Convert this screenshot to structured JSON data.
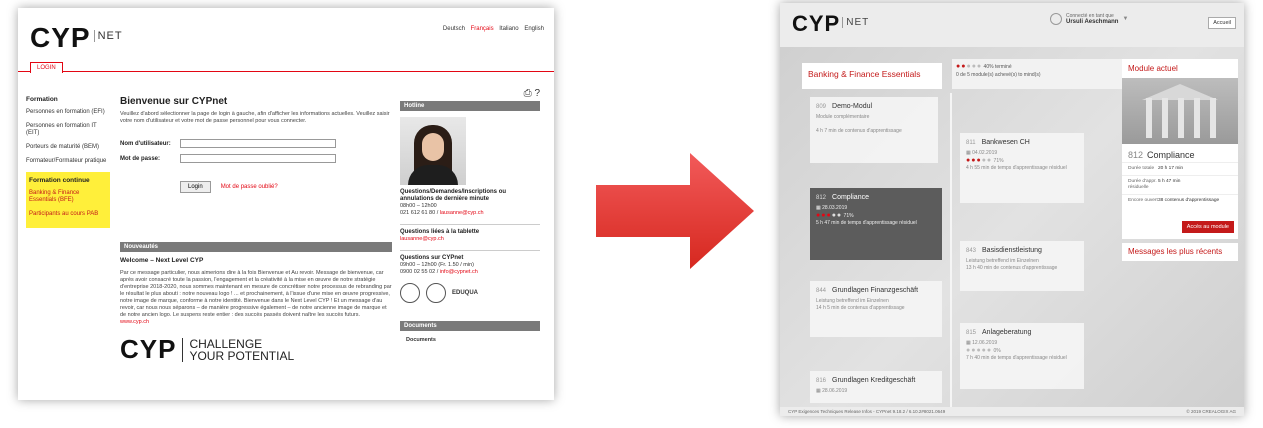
{
  "left": {
    "logo": "CYP",
    "logo_net": "NET",
    "languages": [
      "Deutsch",
      "Français",
      "Italiano",
      "English"
    ],
    "login_tab": "LOGIN",
    "sidebar": {
      "formation_head": "Formation",
      "items": [
        "Personnes en formation (EFI)",
        "Personnes en formation IT (EIT)",
        "Porteurs de maturité (BEM)",
        "Formateur/Formateur pratique"
      ],
      "continue_head": "Formation continue",
      "continue_items": [
        "Banking & Finance Essentials (BFE)",
        "Participants au cours PAB"
      ]
    },
    "welcome_title": "Bienvenue sur CYPnet",
    "welcome_text": "Veuillez d'abord sélectionner la page de login à gauche, afin d'afficher les informations actuelles. Veuillez saisir votre nom d'utilisateur et votre mot de passe personnel pour vous connecter.",
    "username_label": "Nom d'utilisateur:",
    "password_label": "Mot de passe:",
    "login_button": "Login",
    "forgot_link": "Mot de passe oublié?",
    "news_bar": "Nouveautés",
    "news_title": "Welcome – Next Level CYP",
    "news_text": "Par ce message particulier, nous aimerions dire à la fois Bienvenue et Au revoir. Message de bienvenue, car après avoir consacré toute la passion, l'engagement et la créativité à la mise en œuvre de notre stratégie d'entreprise 2018-2020, nous sommes maintenant en mesure de concrétiser notre processus de rebranding par le résultat le plus abouti : notre nouveau logo ! ... et prochainement, à l'issue d'une mise en œuvre progressive, notre image de marque, conforme à notre identité. Bienvenue dans le Next Level CYP ! Et un message d'au revoir, car nous nous séparons – de manière progressive également – de notre ancienne image de marque et de notre ancien logo. Le suspens reste entier : des succès passés doivent naître les succès futurs.",
    "news_link": "www.cyp.ch",
    "tagline_1": "CHALLENGE",
    "tagline_2": "YOUR POTENTIAL",
    "hotline_bar": "Hotline",
    "hotline_title": "Questions/Demandes/Inscriptions ou annulations de dernière minute",
    "hotline_hours": "08h00 – 12h00",
    "hotline_phone": "021 612 61 80 /",
    "hotline_email": "lausanne@cyp.ch",
    "tablet_title": "Questions liées à la tablette",
    "tablet_email": "lausanne@cyp.ch",
    "cypnet_title": "Questions sur CYPnet",
    "cypnet_hours": "09h00 – 12h00 (Fr. 1.50 / min)",
    "cypnet_phone": "0900 02 55 02 /",
    "cypnet_email": "info@cypnet.ch",
    "badge_text": "EDUQUA",
    "documents_bar": "Documents",
    "documents_link": "Documents"
  },
  "right": {
    "logo": "CYP",
    "logo_net": "NET",
    "user_label": "Connecté en tant que",
    "user_name": "Ursuli Aeschmann",
    "accueil_button": "Accueil",
    "course_title": "Banking & Finance Essentials",
    "progress_pct": "40% terminé",
    "progress_modules": "0 de 5 module(s) achevé(s) to mind(s)",
    "cards": [
      {
        "num": "809",
        "title": "Demo-Modul",
        "sub": "Module complémentaire",
        "time": "4 h 7 min de contenus d'apprentissage"
      },
      {
        "num": "811",
        "title": "Bankwesen CH",
        "date": "04.02.2019",
        "pct": "71%",
        "time": "4 h 55 min de temps d'apprentissage résiduel"
      },
      {
        "num": "812",
        "title": "Compliance",
        "date": "28.03.2019",
        "pct": "71%",
        "time": "5 h 47 min de temps d'apprentissage résiduel"
      },
      {
        "num": "843",
        "title": "Basisdienstleistung",
        "sub": "Leistung betreffend im Einzelnen",
        "time": "13 h 40 min de contenus d'apprentissage"
      },
      {
        "num": "844",
        "title": "Grundlagen Finanzgeschäft",
        "sub": "Leistung betreffend im Einzelnen",
        "time": "14 h 5 min de contenus d'apprentissage"
      },
      {
        "num": "815",
        "title": "Anlageberatung",
        "date": "12.06.2019",
        "pct": "0%",
        "time": "7 h 40 min de temps d'apprentissage résiduel"
      },
      {
        "num": "816",
        "title": "Grundlagen Kreditgeschäft",
        "date": "28.06.2019"
      }
    ],
    "module_head": "Module actuel",
    "module_num": "812",
    "module_name": "Compliance",
    "kv": [
      {
        "k": "Durée totale",
        "v": "20 h 17 min"
      },
      {
        "k": "Durée d'appr. résiduelle",
        "v": "5 h 47 min"
      },
      {
        "k": "Encore ouvert",
        "v": "38 contenus d'apprentissage"
      }
    ],
    "acces_button": "Accès au module",
    "messages_title": "Messages les plus récents",
    "footer_left": "CYP    Exigences Techniques    Release Infos - CYPnet 9.18.2 / 6.10.2#8021.0649",
    "footer_right": "© 2019 CREALOGIX AG"
  },
  "colors": {
    "brand_red": "#e30613",
    "accent_dark_red": "#c41a1a",
    "highlight_yellow": "#ffef3a"
  }
}
